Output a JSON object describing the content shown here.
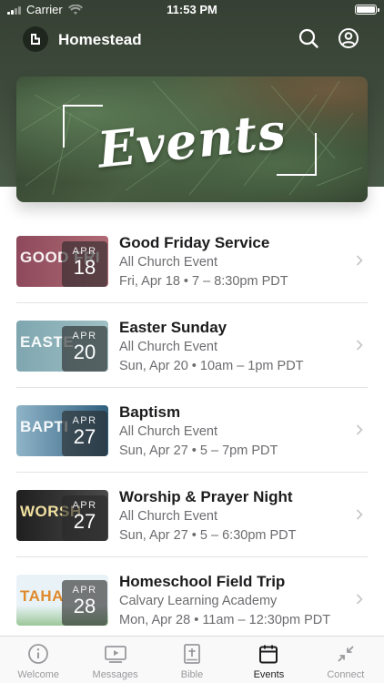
{
  "status_bar": {
    "carrier": "Carrier",
    "time": "11:53 PM"
  },
  "header": {
    "app_title": "Homestead"
  },
  "banner": {
    "title": "Events"
  },
  "events": [
    {
      "title": "Good Friday Service",
      "subtitle": "All Church Event",
      "time": "Fri, Apr 18 • 7 – 8:30pm PDT",
      "month": "APR",
      "day": "18",
      "thumb_text": "GOOD FRI",
      "thumb_colors": [
        "#8e4a5c",
        "#b06a74"
      ]
    },
    {
      "title": "Easter Sunday",
      "subtitle": "All Church Event",
      "time": "Sun, Apr 20 • 10am – 1pm PDT",
      "month": "APR",
      "day": "20",
      "thumb_text": "EASTE",
      "thumb_colors": [
        "#7fa6b0",
        "#9fc0c4"
      ]
    },
    {
      "title": "Baptism",
      "subtitle": "All Church Event",
      "time": "Sun, Apr 27 • 5 – 7pm PDT",
      "month": "APR",
      "day": "27",
      "thumb_text": "BAPTI",
      "thumb_colors": [
        "#8fb4c8",
        "#2f5f7e"
      ]
    },
    {
      "title": "Worship & Prayer Night",
      "subtitle": "All Church Event",
      "time": "Sun, Apr 27 • 5 – 6:30pm PDT",
      "month": "APR",
      "day": "27",
      "thumb_text": "WORSH",
      "thumb_colors": [
        "#1f1f1f",
        "#4a4a4a"
      ]
    },
    {
      "title": "Homeschool Field Trip",
      "subtitle": "Calvary Learning Academy",
      "time": "Mon, Apr 28 • 11am – 12:30pm PDT",
      "month": "APR",
      "day": "28",
      "thumb_text": "TAHA",
      "thumb_colors": [
        "#e9f3f7",
        "#9cc79a"
      ]
    }
  ],
  "tab_bar": {
    "tabs": [
      {
        "label": "Welcome",
        "icon": "info-circle-icon"
      },
      {
        "label": "Messages",
        "icon": "video-play-icon"
      },
      {
        "label": "Bible",
        "icon": "bible-cross-icon"
      },
      {
        "label": "Events",
        "icon": "calendar-icon",
        "active": true
      },
      {
        "label": "Connect",
        "icon": "connect-arrows-icon"
      }
    ]
  },
  "colors": {
    "header_green": "#3d4a3b",
    "active_tab": "#1c1c1e",
    "inactive_tab": "#9a9a9e"
  }
}
